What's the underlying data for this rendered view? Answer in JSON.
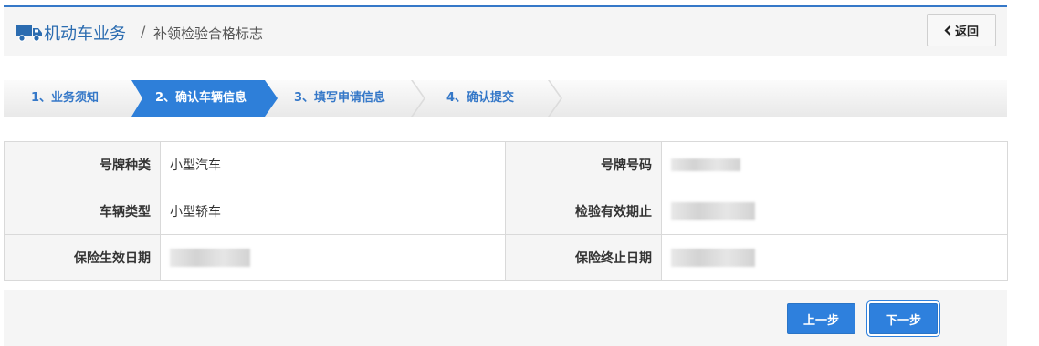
{
  "header": {
    "title": "机动车业务",
    "separator": "/",
    "subtitle": "补领检验合格标志",
    "back_label": "返回",
    "back_icon": "chevron-left-icon",
    "title_icon": "truck-icon"
  },
  "steps": [
    {
      "label": "1、业务须知",
      "active": false
    },
    {
      "label": "2、确认车辆信息",
      "active": true
    },
    {
      "label": "3、填写申请信息",
      "active": false
    },
    {
      "label": "4、确认提交",
      "active": false
    }
  ],
  "info": {
    "rows": [
      {
        "label1": "号牌种类",
        "value1": "小型汽车",
        "label2": "号牌号码",
        "value2": ""
      },
      {
        "label1": "车辆类型",
        "value1": "小型轿车",
        "label2": "检验有效期止",
        "value2": ""
      },
      {
        "label1": "保险生效日期",
        "value1": "",
        "label2": "保险终止日期",
        "value2": ""
      }
    ]
  },
  "footer": {
    "prev_label": "上一步",
    "next_label": "下一步"
  },
  "colors": {
    "accent": "#2e7fd9",
    "header_border": "#3578c8",
    "panel_bg": "#f5f5f5"
  }
}
